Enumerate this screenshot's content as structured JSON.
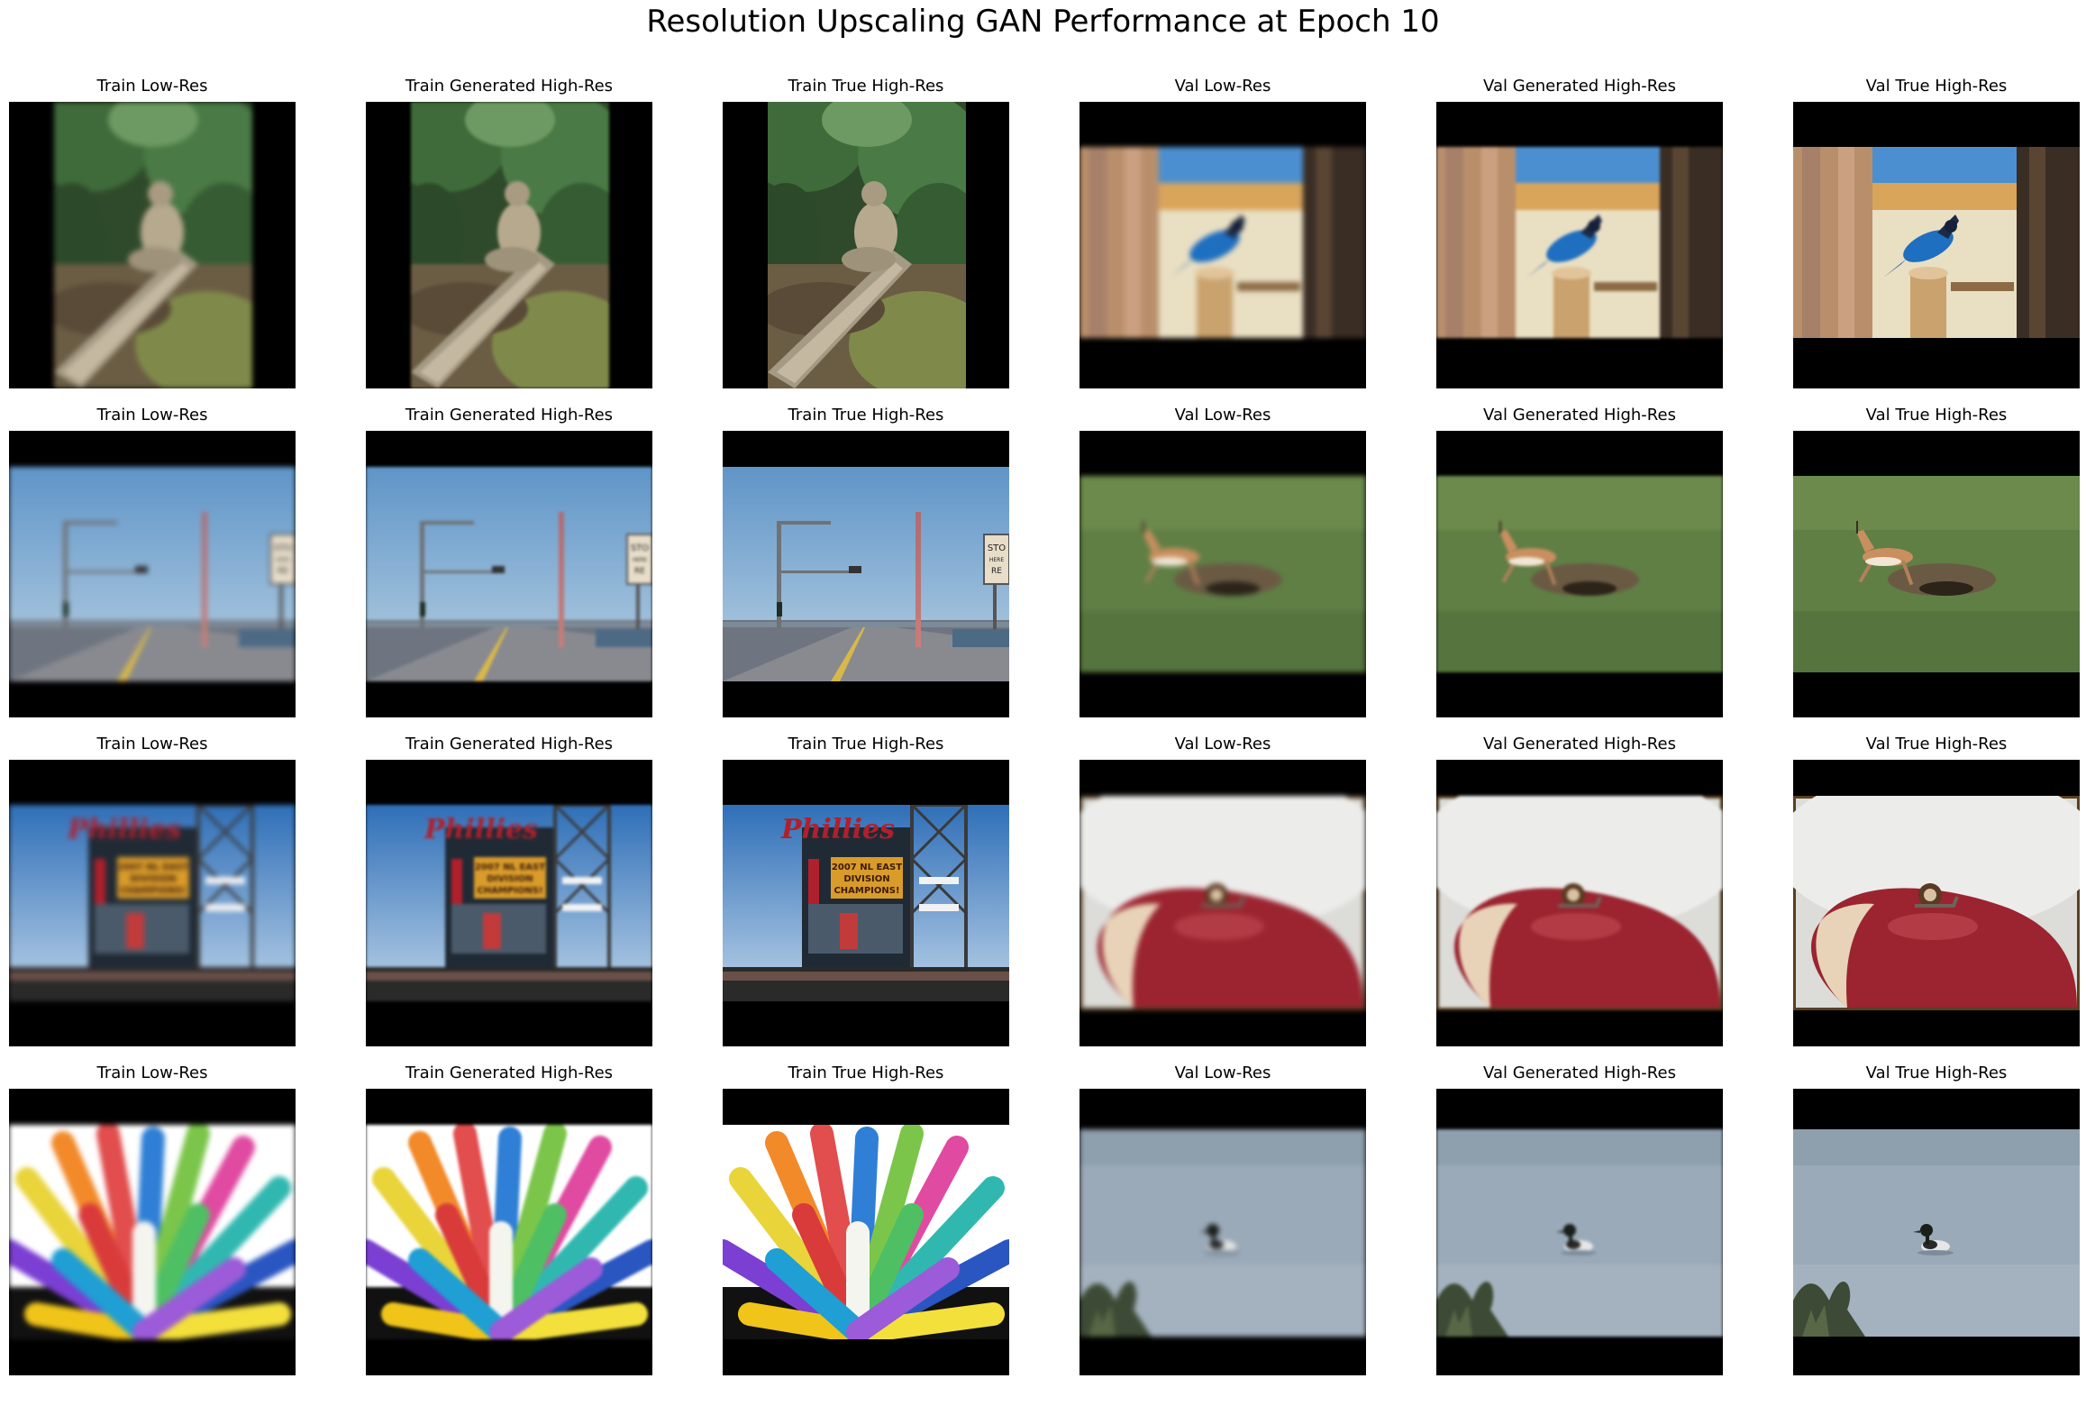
{
  "figure": {
    "title": "Resolution Upscaling GAN Performance at Epoch 10"
  },
  "rows": [
    {
      "panels": [
        {
          "label": "Train Low-Res",
          "subject": "monkey-on-log",
          "quality": "low"
        },
        {
          "label": "Train Generated High-Res",
          "subject": "monkey-on-log",
          "quality": "gen"
        },
        {
          "label": "Train True High-Res",
          "subject": "monkey-on-log",
          "quality": "true"
        },
        {
          "label": "Val Low-Res",
          "subject": "blue-jay",
          "quality": "low"
        },
        {
          "label": "Val Generated High-Res",
          "subject": "blue-jay",
          "quality": "gen"
        },
        {
          "label": "Val True High-Res",
          "subject": "blue-jay",
          "quality": "true"
        }
      ]
    },
    {
      "panels": [
        {
          "label": "Train Low-Res",
          "subject": "bridge-road",
          "quality": "low"
        },
        {
          "label": "Train Generated High-Res",
          "subject": "bridge-road",
          "quality": "gen"
        },
        {
          "label": "Train True High-Res",
          "subject": "bridge-road",
          "quality": "true"
        },
        {
          "label": "Val Low-Res",
          "subject": "gazelle",
          "quality": "low"
        },
        {
          "label": "Val Generated High-Res",
          "subject": "gazelle",
          "quality": "gen"
        },
        {
          "label": "Val True High-Res",
          "subject": "gazelle",
          "quality": "true"
        }
      ]
    },
    {
      "panels": [
        {
          "label": "Train Low-Res",
          "subject": "scoreboard",
          "quality": "low"
        },
        {
          "label": "Train Generated High-Res",
          "subject": "scoreboard",
          "quality": "gen"
        },
        {
          "label": "Train True High-Res",
          "subject": "scoreboard",
          "quality": "true"
        },
        {
          "label": "Val Low-Res",
          "subject": "snail",
          "quality": "low"
        },
        {
          "label": "Val Generated High-Res",
          "subject": "snail",
          "quality": "gen"
        },
        {
          "label": "Val True High-Res",
          "subject": "snail",
          "quality": "true"
        }
      ]
    },
    {
      "panels": [
        {
          "label": "Train Low-Res",
          "subject": "markers",
          "quality": "low"
        },
        {
          "label": "Train Generated High-Res",
          "subject": "markers",
          "quality": "gen"
        },
        {
          "label": "Train True High-Res",
          "subject": "markers",
          "quality": "true"
        },
        {
          "label": "Val Low-Res",
          "subject": "duck",
          "quality": "low"
        },
        {
          "label": "Val Generated High-Res",
          "subject": "duck",
          "quality": "gen"
        },
        {
          "label": "Val True High-Res",
          "subject": "duck",
          "quality": "true"
        }
      ]
    }
  ],
  "scoreboard_text": {
    "team": "Phillies",
    "banner_line1": "2007 NL EAST",
    "banner_line2": "DIVISION",
    "banner_line3": "CHAMPIONS!"
  },
  "sign_text": {
    "line1": "STO",
    "line2": "HERE",
    "line3": "RE"
  }
}
